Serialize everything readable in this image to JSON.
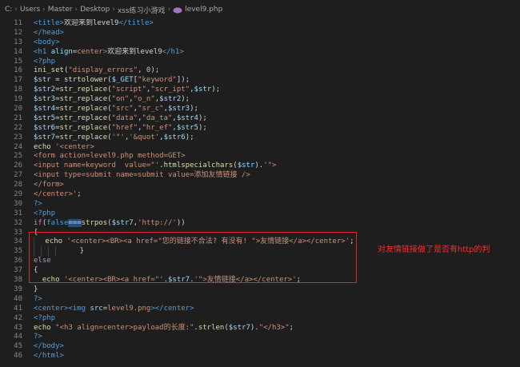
{
  "breadcrumb": {
    "items": [
      "C:",
      "Users",
      "Master",
      "Desktop",
      "xss练习小游戏"
    ],
    "file": "level9.php"
  },
  "annotation": "对友情链接做了是否有http的判",
  "lines": [
    {
      "n": "11",
      "t": [
        [
          "tag",
          "<title>"
        ],
        [
          "txt",
          "欢迎来到level9"
        ],
        [
          "tag",
          "</title>"
        ]
      ]
    },
    {
      "n": "12",
      "t": [
        [
          "tag",
          "</head>"
        ]
      ]
    },
    {
      "n": "13",
      "t": [
        [
          "tag",
          "<body>"
        ]
      ]
    },
    {
      "n": "14",
      "t": [
        [
          "tag",
          "<h1 "
        ],
        [
          "attr",
          "align"
        ],
        [
          "txt",
          "="
        ],
        [
          "str",
          "center"
        ],
        [
          "tag",
          ">"
        ],
        [
          "txt",
          "欢迎来到level9"
        ],
        [
          "tag",
          "</h1>"
        ]
      ]
    },
    {
      "n": "15",
      "t": [
        [
          "php",
          "<?php"
        ]
      ]
    },
    {
      "n": "16",
      "t": [
        [
          "fn",
          "ini_set"
        ],
        [
          "txt",
          "("
        ],
        [
          "str",
          "\"display_errors\""
        ],
        [
          "txt",
          ", "
        ],
        [
          "num",
          "0"
        ],
        [
          "txt",
          ");"
        ]
      ]
    },
    {
      "n": "17",
      "t": [
        [
          "var",
          "$str"
        ],
        [
          "txt",
          " = "
        ],
        [
          "fn",
          "strtolower"
        ],
        [
          "txt",
          "("
        ],
        [
          "var",
          "$_GET"
        ],
        [
          "txt",
          "["
        ],
        [
          "str",
          "\"keyword\""
        ],
        [
          "txt",
          "]);"
        ]
      ]
    },
    {
      "n": "18",
      "t": [
        [
          "var",
          "$str2"
        ],
        [
          "txt",
          "="
        ],
        [
          "fn",
          "str_replace"
        ],
        [
          "txt",
          "("
        ],
        [
          "str",
          "\"script\""
        ],
        [
          "txt",
          ","
        ],
        [
          "str",
          "\"scr_ipt\""
        ],
        [
          "txt",
          ","
        ],
        [
          "var",
          "$str"
        ],
        [
          "txt",
          ");"
        ]
      ]
    },
    {
      "n": "19",
      "t": [
        [
          "var",
          "$str3"
        ],
        [
          "txt",
          "="
        ],
        [
          "fn",
          "str_replace"
        ],
        [
          "txt",
          "("
        ],
        [
          "str",
          "\"on\""
        ],
        [
          "txt",
          ","
        ],
        [
          "str",
          "\"o_n\""
        ],
        [
          "txt",
          ","
        ],
        [
          "var",
          "$str2"
        ],
        [
          "txt",
          ");"
        ]
      ]
    },
    {
      "n": "20",
      "t": [
        [
          "var",
          "$str4"
        ],
        [
          "txt",
          "="
        ],
        [
          "fn",
          "str_replace"
        ],
        [
          "txt",
          "("
        ],
        [
          "str",
          "\"src\""
        ],
        [
          "txt",
          ","
        ],
        [
          "str",
          "\"sr_c\""
        ],
        [
          "txt",
          ","
        ],
        [
          "var",
          "$str3"
        ],
        [
          "txt",
          ");"
        ]
      ]
    },
    {
      "n": "21",
      "t": [
        [
          "var",
          "$str5"
        ],
        [
          "txt",
          "="
        ],
        [
          "fn",
          "str_replace"
        ],
        [
          "txt",
          "("
        ],
        [
          "str",
          "\"data\""
        ],
        [
          "txt",
          ","
        ],
        [
          "str",
          "\"da_ta\""
        ],
        [
          "txt",
          ","
        ],
        [
          "var",
          "$str4"
        ],
        [
          "txt",
          ");"
        ]
      ]
    },
    {
      "n": "22",
      "t": [
        [
          "var",
          "$str6"
        ],
        [
          "txt",
          "="
        ],
        [
          "fn",
          "str_replace"
        ],
        [
          "txt",
          "("
        ],
        [
          "str",
          "\"href\""
        ],
        [
          "txt",
          ","
        ],
        [
          "str",
          "\"hr_ef\""
        ],
        [
          "txt",
          ","
        ],
        [
          "var",
          "$str5"
        ],
        [
          "txt",
          ");"
        ]
      ]
    },
    {
      "n": "23",
      "t": [
        [
          "var",
          "$str7"
        ],
        [
          "txt",
          "="
        ],
        [
          "fn",
          "str_replace"
        ],
        [
          "txt",
          "("
        ],
        [
          "str",
          "'\"'"
        ],
        [
          "txt",
          ","
        ],
        [
          "str",
          "'&quot'"
        ],
        [
          "txt",
          ","
        ],
        [
          "var",
          "$str6"
        ],
        [
          "txt",
          ");"
        ]
      ]
    },
    {
      "n": "24",
      "t": [
        [
          "fn",
          "echo"
        ],
        [
          "txt",
          " "
        ],
        [
          "str",
          "'<center>"
        ]
      ]
    },
    {
      "n": "25",
      "t": [
        [
          "str",
          "<form action=level9.php method=GET>"
        ]
      ]
    },
    {
      "n": "26",
      "t": [
        [
          "str",
          "<input name=keyword  value=\"'"
        ],
        [
          "txt",
          "."
        ],
        [
          "fn",
          "htmlspecialchars"
        ],
        [
          "txt",
          "("
        ],
        [
          "var",
          "$str"
        ],
        [
          "txt",
          ")."
        ],
        [
          "str",
          "'\">"
        ]
      ]
    },
    {
      "n": "27",
      "t": [
        [
          "str",
          "<input type=submit name=submit value=添加友情链接 />"
        ]
      ]
    },
    {
      "n": "28",
      "t": [
        [
          "str",
          "</form>"
        ]
      ]
    },
    {
      "n": "29",
      "t": [
        [
          "str",
          "</center>'"
        ],
        [
          "txt",
          ";"
        ]
      ]
    },
    {
      "n": "30",
      "t": [
        [
          "php",
          "?>"
        ]
      ]
    },
    {
      "n": "31",
      "t": [
        [
          "php",
          "<?php"
        ]
      ]
    },
    {
      "n": "32",
      "t": [
        [
          "kw",
          "if"
        ],
        [
          "txt",
          "("
        ],
        [
          "tag",
          "false"
        ],
        [
          "hl",
          "==="
        ],
        [
          "fn",
          "strpos"
        ],
        [
          "txt",
          "("
        ],
        [
          "var",
          "$str7"
        ],
        [
          "txt",
          ","
        ],
        [
          "str",
          "'http://'"
        ],
        [
          "txt",
          "))"
        ]
      ]
    },
    {
      "n": "33",
      "t": [
        [
          "txt",
          "{"
        ]
      ]
    },
    {
      "n": "34",
      "t": [
        [
          "guide",
          ""
        ],
        [
          "txt",
          " "
        ],
        [
          "fn",
          "echo"
        ],
        [
          "txt",
          " "
        ],
        [
          "str",
          "'<center><BR><a href=\"您的链接不合法? 有没有! \">友情链接</a></center>'"
        ],
        [
          "txt",
          ";"
        ]
      ]
    },
    {
      "n": "35",
      "t": [
        [
          "guide",
          ""
        ],
        [
          "guide",
          ""
        ],
        [
          "guide",
          ""
        ],
        [
          "guide",
          ""
        ],
        [
          "txt",
          "    }"
        ]
      ]
    },
    {
      "n": "36",
      "t": [
        [
          "kw",
          "else"
        ]
      ]
    },
    {
      "n": "37",
      "t": [
        [
          "txt",
          "{"
        ]
      ]
    },
    {
      "n": "38",
      "t": [
        [
          "txt",
          "  "
        ],
        [
          "fn",
          "echo"
        ],
        [
          "txt",
          " "
        ],
        [
          "str",
          "'<center><BR><a href=\"'"
        ],
        [
          "txt",
          "."
        ],
        [
          "var",
          "$str7"
        ],
        [
          "txt",
          "."
        ],
        [
          "str",
          "'\">友情链接</a></center>'"
        ],
        [
          "txt",
          ";"
        ]
      ]
    },
    {
      "n": "39",
      "t": [
        [
          "txt",
          "}"
        ]
      ]
    },
    {
      "n": "40",
      "t": [
        [
          "php",
          "?>"
        ]
      ]
    },
    {
      "n": "41",
      "t": [
        [
          "tag",
          "<center><img "
        ],
        [
          "attr",
          "src"
        ],
        [
          "txt",
          "="
        ],
        [
          "str",
          "level9.png"
        ],
        [
          "tag",
          "></center>"
        ]
      ]
    },
    {
      "n": "42",
      "t": [
        [
          "php",
          "<?php"
        ]
      ]
    },
    {
      "n": "43",
      "t": [
        [
          "fn",
          "echo"
        ],
        [
          "txt",
          " "
        ],
        [
          "str",
          "\"<h3 align=center>payload的长度:\""
        ],
        [
          "txt",
          "."
        ],
        [
          "fn",
          "strlen"
        ],
        [
          "txt",
          "("
        ],
        [
          "var",
          "$str7"
        ],
        [
          "txt",
          ")."
        ],
        [
          "str",
          "\"</h3>\""
        ],
        [
          "txt",
          ";"
        ]
      ]
    },
    {
      "n": "44",
      "t": [
        [
          "php",
          "?>"
        ]
      ]
    },
    {
      "n": "45",
      "t": [
        [
          "tag",
          "</body>"
        ]
      ]
    },
    {
      "n": "46",
      "t": [
        [
          "tag",
          "</html>"
        ]
      ]
    }
  ],
  "colors": {
    "background": "#1e1e1e",
    "annotation": "#ff2a2a",
    "highlight_box": "#e02828"
  }
}
